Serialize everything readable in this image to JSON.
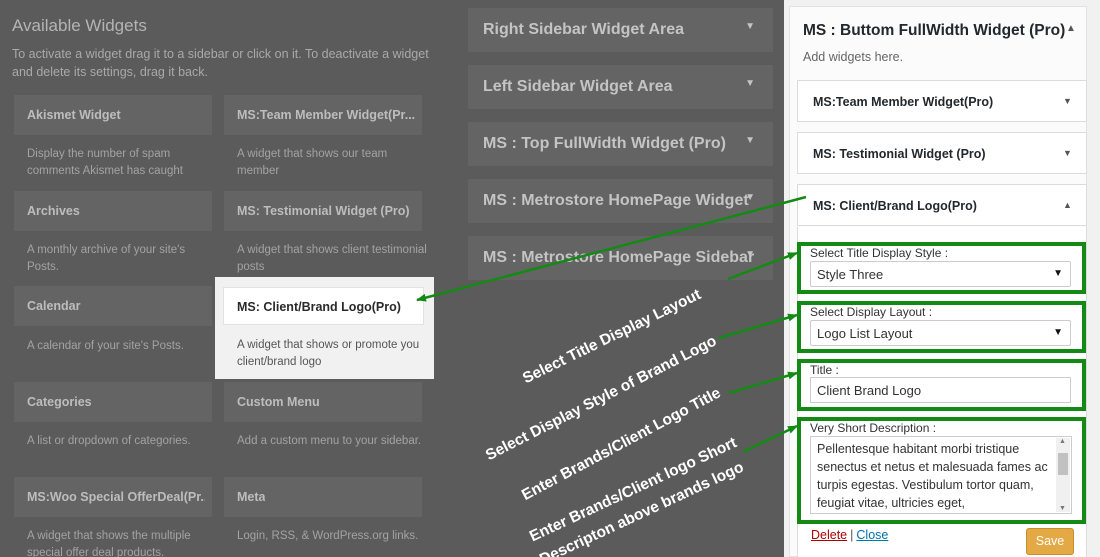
{
  "available": {
    "title": "Available Widgets",
    "description": "To activate a widget drag it to a sidebar or click on it. To deactivate a widget and delete its settings, drag it back."
  },
  "widgets": {
    "akismet": {
      "name": "Akismet Widget",
      "desc": "Display the number of spam comments Akismet has caught"
    },
    "team": {
      "name": "MS:Team Member Widget(Pr...",
      "desc": "A widget that shows our team member"
    },
    "archives": {
      "name": "Archives",
      "desc": "A monthly archive of your site's Posts."
    },
    "testimonial": {
      "name": "MS: Testimonial Widget (Pro)",
      "desc": "A widget that shows client testimonial posts"
    },
    "calendar": {
      "name": "Calendar",
      "desc": "A calendar of your site's Posts."
    },
    "client": {
      "name": "MS: Client/Brand Logo(Pro)",
      "desc": "A widget that shows or promote you client/brand logo"
    },
    "categories": {
      "name": "Categories",
      "desc": "A list or dropdown of categories."
    },
    "custom_menu": {
      "name": "Custom Menu",
      "desc": "Add a custom menu to your sidebar."
    },
    "woo": {
      "name": "MS:Woo Special OfferDeal(Pr...",
      "desc": "A widget that shows the multiple special offer deal products."
    },
    "meta": {
      "name": "Meta",
      "desc": "Login, RSS, & WordPress.org links."
    }
  },
  "areas": [
    "Right Sidebar Widget Area",
    "Left Sidebar Widget Area",
    "MS : Top FullWidth Widget (Pro)",
    "MS : Metrostore HomePage Widget",
    "MS : Metrostore HomePage Sidebar"
  ],
  "panel": {
    "title": "MS : Buttom FullWidth Widget (Pro)",
    "subtitle": "Add widgets here.",
    "items": [
      "MS:Team Member Widget(Pro)",
      "MS: Testimonial Widget (Pro)",
      "MS: Client/Brand Logo(Pro)"
    ],
    "form": {
      "title_style_label": "Select Title Display Style :",
      "title_style_value": "Style Three",
      "layout_label": "Select Display Layout :",
      "layout_value": "Logo List Layout",
      "title_label": "Title :",
      "title_value": "Client Brand Logo",
      "desc_label": "Very Short Description :",
      "desc_value": "Pellentesque habitant morbi tristique senectus et netus et malesuada fames ac turpis egestas. Vestibulum tortor quam, feugiat vitae, ultricies eget,"
    },
    "delete_label": "Delete",
    "separator": "|",
    "close_label": "Close",
    "save_label": "Save"
  },
  "annotations": {
    "a1": "Select Title Display Layout",
    "a2": "Select Display Style of Brand Logo",
    "a3": "Enter Brands/Client Logo Title",
    "a4_line1": "Enter Brands/Client logo Short",
    "a4_line2": "Descripton above brands logo"
  },
  "colors": {
    "highlight_green": "#138a13",
    "save_orange": "#e2a945",
    "delete_red": "#aa0000",
    "link_blue": "#0073aa"
  },
  "icons": {
    "collapse": "triangle-down-icon",
    "expand": "triangle-up-icon",
    "arrow": "green-arrow"
  }
}
